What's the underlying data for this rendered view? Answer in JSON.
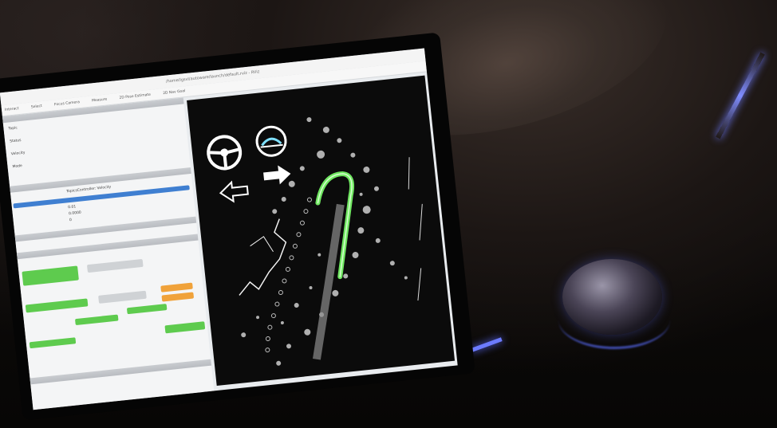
{
  "scene": {
    "description_label": "",
    "icons": [
      "steering-wheel-icon",
      "autonomy-indicator-icon",
      "left-arrow-icon",
      "right-arrow-icon"
    ]
  },
  "tablet_ui": {
    "window_title": "/home/lgsvl/autoware/launch/default.rviz - RViz",
    "toolbar_items": [
      "Interact",
      "Select",
      "Focus Camera",
      "Measure",
      "2D Pose Estimate",
      "2D Nav Goal"
    ],
    "panel": {
      "fields": [
        "Topic",
        "Status",
        "Velocity",
        "Mode"
      ],
      "selected_value": "TopicsController: Velocity",
      "values": [
        "0.01",
        "0.0000",
        "0"
      ]
    }
  },
  "colors": {
    "path_green": "#7bff6a",
    "button_green": "#5ecb4e",
    "button_orange": "#f0a23a",
    "ambient_blue": "#6c7bff"
  }
}
